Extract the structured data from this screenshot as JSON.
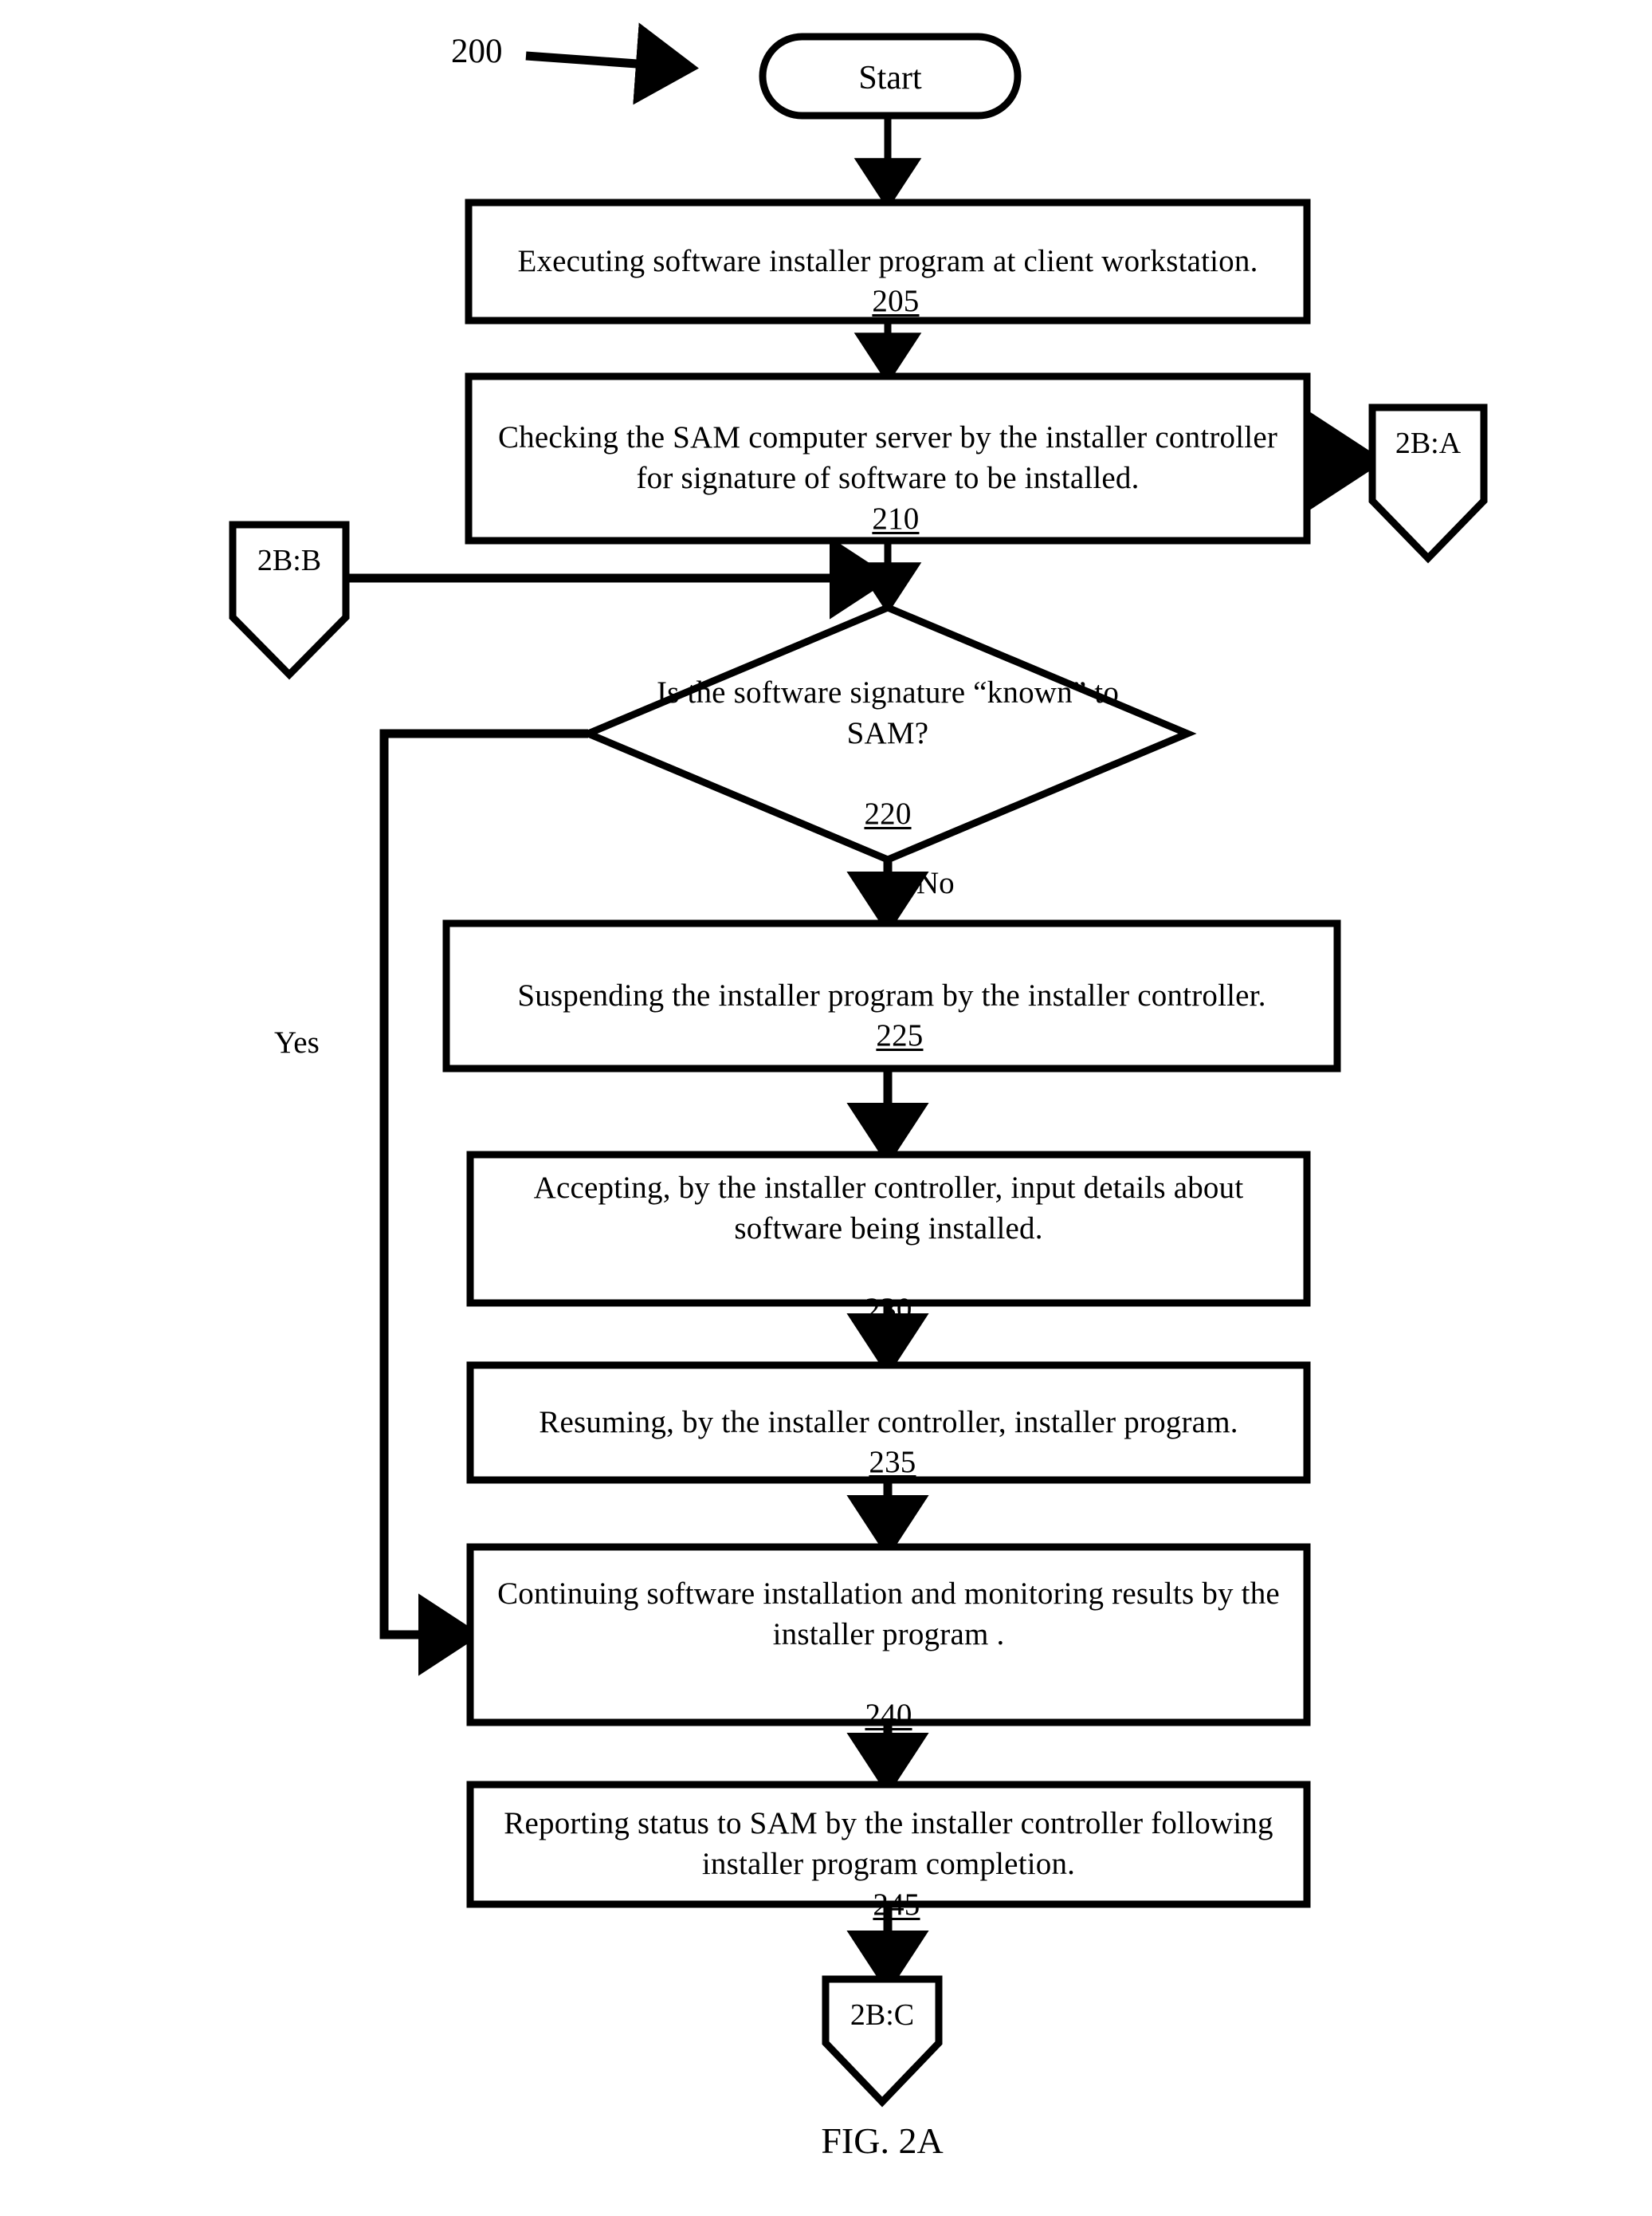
{
  "figure": {
    "caption": "FIG. 2A",
    "reference_numeral": "200"
  },
  "nodes": {
    "start": {
      "label": "Start",
      "shape": "terminator"
    },
    "step_205": {
      "text": "Executing software installer program at client workstation.",
      "ref": "205",
      "shape": "process"
    },
    "step_210": {
      "text": "Checking the SAM computer server by the installer controller for signature of software to be installed.",
      "ref": "210",
      "shape": "process"
    },
    "decision_220": {
      "text": "Is the software signature “known” to SAM?",
      "ref": "220",
      "shape": "decision"
    },
    "step_225": {
      "text": "Suspending the installer program by the installer controller.",
      "ref": "225",
      "shape": "process"
    },
    "step_230": {
      "text": "Accepting, by the installer controller, input details about software being installed.",
      "ref": "230",
      "shape": "process"
    },
    "step_235": {
      "text": "Resuming, by the installer controller, installer program.",
      "ref": "235",
      "shape": "process"
    },
    "step_240": {
      "text": "Continuing software installation and monitoring results by the installer program .",
      "ref": "240",
      "shape": "process"
    },
    "step_245": {
      "text": "Reporting status to SAM by the installer controller following installer program completion.",
      "ref": "245",
      "shape": "process"
    }
  },
  "connectors": {
    "out_a": {
      "label": "2B:A"
    },
    "in_b": {
      "label": "2B:B"
    },
    "out_c": {
      "label": "2B:C"
    }
  },
  "edge_labels": {
    "decision_no": "No",
    "decision_yes": "Yes"
  },
  "style": {
    "stroke": "#000000",
    "fill": "#ffffff",
    "background": "#ffffff"
  }
}
